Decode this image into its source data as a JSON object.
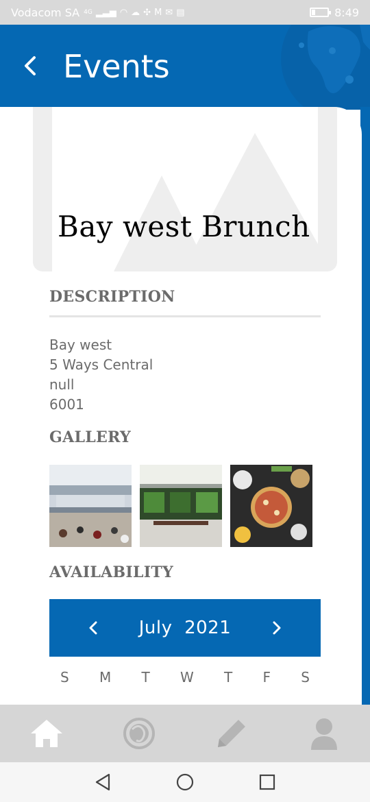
{
  "status_bar": {
    "carrier": "Vodacom SA",
    "network": "4G",
    "time": "8:49"
  },
  "header": {
    "title": "Events"
  },
  "event": {
    "title": "Bay west Brunch"
  },
  "description": {
    "heading": "DESCRIPTION",
    "lines": [
      "Bay west",
      "5 Ways Central",
      "null",
      "6001"
    ]
  },
  "gallery": {
    "heading": "GALLERY",
    "images": [
      "mall-interior",
      "restaurant-front",
      "food-platter"
    ]
  },
  "availability": {
    "heading": "AVAILABILITY",
    "month": "July",
    "year": "2021",
    "weekdays": [
      "S",
      "M",
      "T",
      "W",
      "T",
      "F",
      "S"
    ]
  },
  "bottom_nav": {
    "items": [
      "home-icon",
      "explore-icon",
      "edit-icon",
      "profile-icon"
    ]
  },
  "colors": {
    "primary": "#0568b3",
    "text_muted": "#6b6b6b",
    "nav_bg": "#d6d6d6"
  }
}
